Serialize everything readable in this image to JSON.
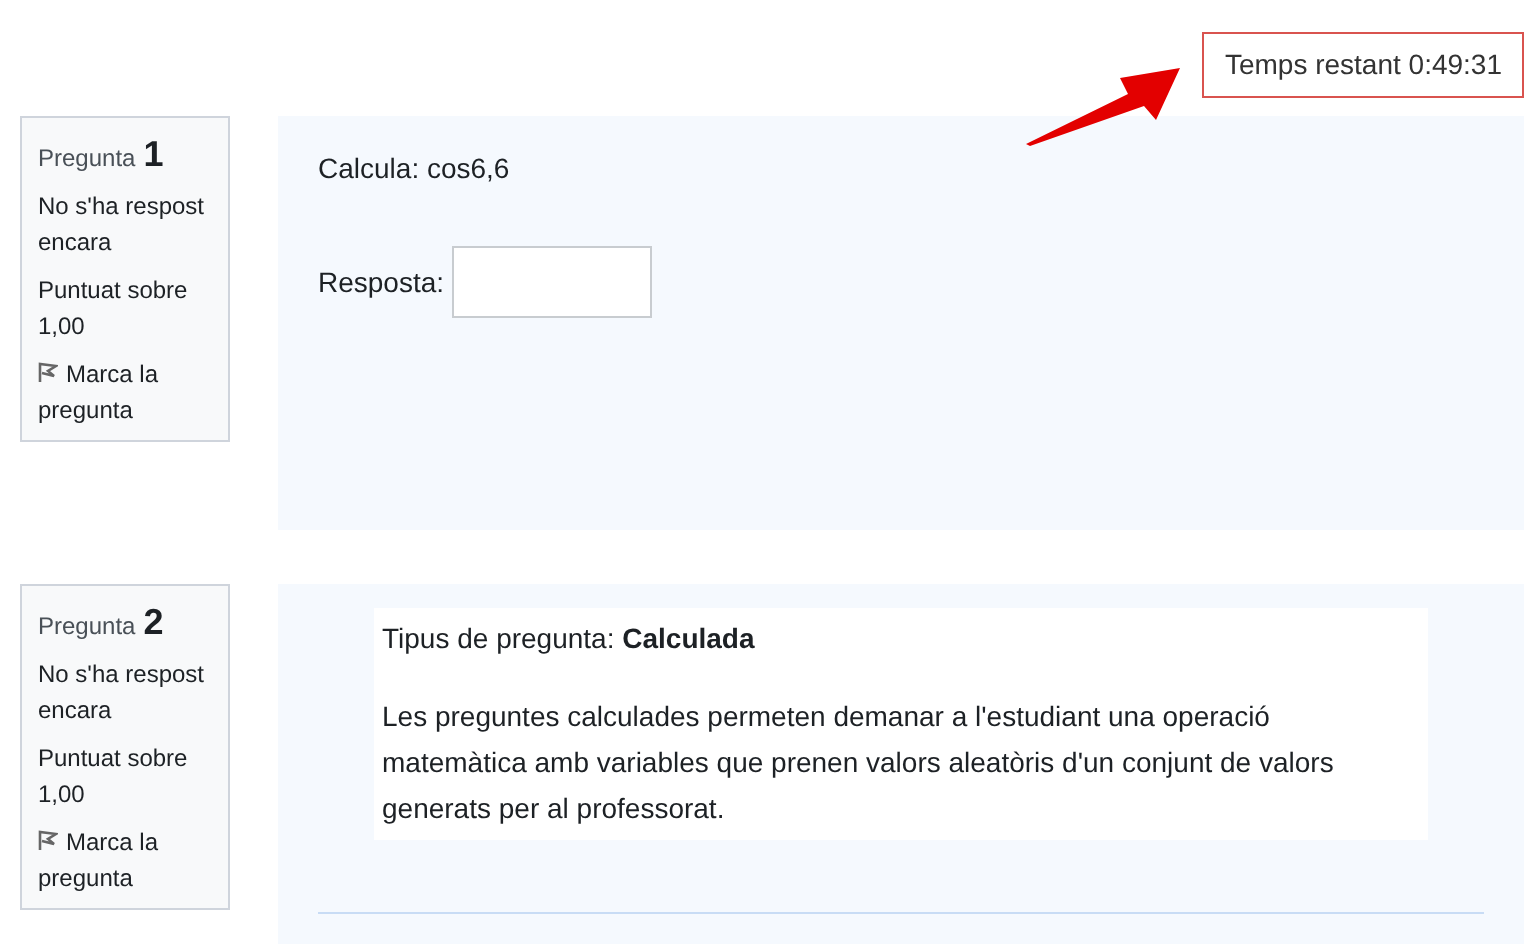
{
  "timer": {
    "label": "Temps restant 0:49:31"
  },
  "questions": [
    {
      "kind": "answer",
      "label": "Pregunta",
      "number": "1",
      "status": "No s'ha respost encara",
      "marks": "Puntuat sobre 1,00",
      "flag": "Marca la pregunta",
      "prompt": "Calcula: cos6,6",
      "answer_label": "Resposta:"
    },
    {
      "kind": "info",
      "label": "Pregunta",
      "number": "2",
      "status": "No s'ha respost encara",
      "marks": "Puntuat sobre 1,00",
      "flag": "Marca la pregunta",
      "type_line": "Tipus de pregunta: **Calculada**",
      "description": "Les preguntes calculades permeten demanar a l'estudiant una operació matemàtica amb variables que prenen valors aleatòris d'un conjunt de valors generats per al professorat."
    }
  ]
}
